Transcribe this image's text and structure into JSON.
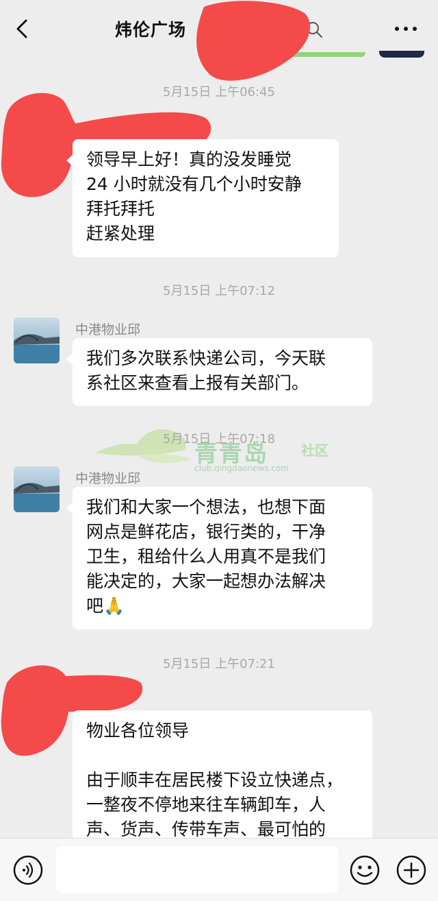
{
  "header": {
    "title": "炜伦广场"
  },
  "messages": [
    {
      "timestamp": "5月15日 上午06:45",
      "sender": "",
      "text": "领导早上好！真的没发睡觉\n24 小时就没有几个小时安静\n拜托拜托\n赶紧处理"
    },
    {
      "timestamp": "5月15日 上午07:12",
      "sender": "中港物业邱",
      "text": "我们多次联系快递公司，今天联\n系社区来查看上报有关部门。"
    },
    {
      "timestamp": "5月15日 上午07:18",
      "sender": "中港物业邱",
      "text": "我们和大家一个想法，也想下面\n网点是鲜花店，银行类的，干净\n卫生，租给什么人用真不是我们\n能决定的，大家一起想办法解决\n吧🙏"
    },
    {
      "timestamp": "5月15日 上午07:21",
      "sender": "",
      "text": "物业各位领导\n\n由于顺丰在居民楼下设立快递点，\n一整夜不停地来往车辆卸车，人\n声、货声、传带车声、最可怕的"
    }
  ],
  "watermark": {
    "brand": "青青岛",
    "tag": "社区",
    "url": "club.qingdaonews.com"
  },
  "input_bar": {
    "placeholder": ""
  },
  "colors": {
    "background": "#ededed",
    "bubble": "#ffffff",
    "timestamp": "#a8a8a8",
    "redaction": "#f44a4a"
  },
  "icons": {
    "back": "chevron-left-icon",
    "search": "search-icon",
    "more": "more-icon",
    "voice": "voice-icon",
    "emoji": "emoji-icon",
    "plus": "plus-icon"
  }
}
